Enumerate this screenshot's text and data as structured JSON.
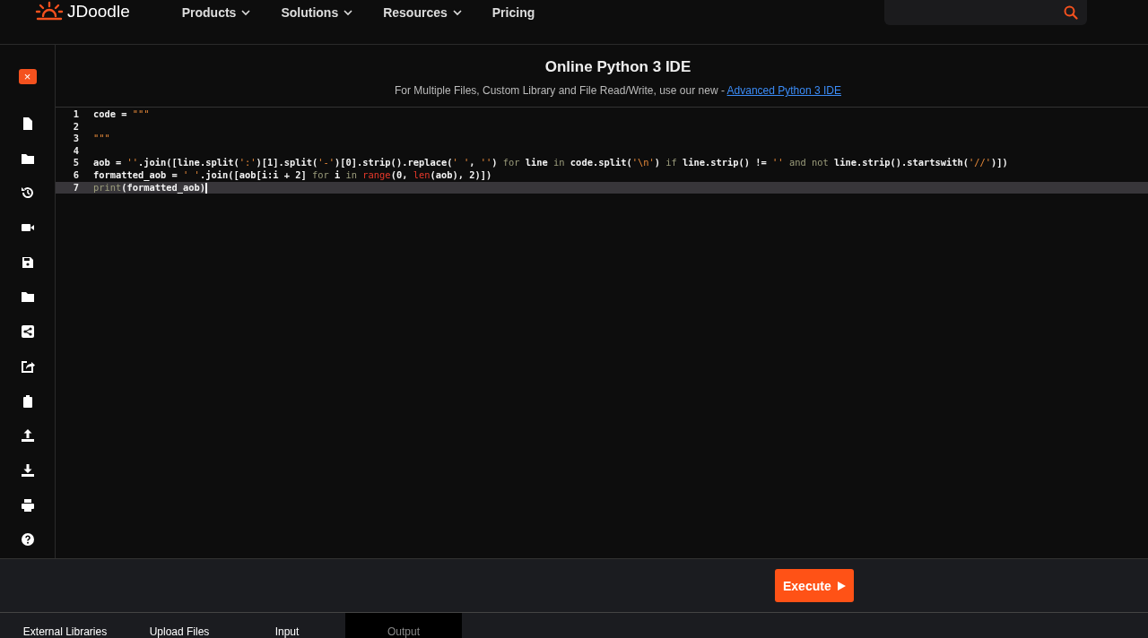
{
  "header": {
    "logo": "JDoodle",
    "nav": [
      {
        "label": "Products",
        "dropdown": true
      },
      {
        "label": "Solutions",
        "dropdown": true
      },
      {
        "label": "Resources",
        "dropdown": true
      },
      {
        "label": "Pricing",
        "dropdown": false
      }
    ]
  },
  "sidebar": {
    "close": "×",
    "tools": [
      {
        "kind": "file"
      },
      {
        "kind": "folder"
      },
      {
        "kind": "history"
      },
      {
        "kind": "video"
      },
      {
        "kind": "save"
      },
      {
        "kind": "folder"
      },
      {
        "kind": "share"
      },
      {
        "kind": "export"
      },
      {
        "kind": "clipboard"
      },
      {
        "kind": "upload"
      },
      {
        "kind": "download"
      },
      {
        "kind": "print"
      },
      {
        "kind": "help"
      }
    ]
  },
  "title": "Online Python 3 IDE",
  "subtitle": {
    "text": "For Multiple Files, Custom Library and File Read/Write, use our new - ",
    "link": "Advanced Python 3 IDE"
  },
  "editor": {
    "lines": [
      {
        "number": "1",
        "selected": false,
        "tokens": [
          {
            "text": "code = ",
            "kind": "plain"
          },
          {
            "text": "\"\"\"",
            "kind": "string"
          }
        ]
      },
      {
        "number": "2",
        "selected": false
      },
      {
        "number": "3",
        "selected": false,
        "tokens": [
          {
            "text": "\"\"\"",
            "kind": "string"
          }
        ]
      },
      {
        "number": "4",
        "selected": false
      },
      {
        "number": "5",
        "selected": false,
        "tokens": [
          {
            "text": "aob = ",
            "kind": "plain"
          },
          {
            "text": "''",
            "kind": "string"
          },
          {
            "text": ".join([line.split(",
            "kind": "plain"
          },
          {
            "text": "':'",
            "kind": "string"
          },
          {
            "text": ")[1].split(",
            "kind": "plain"
          },
          {
            "text": "'-'",
            "kind": "string"
          },
          {
            "text": ")[0].strip().replace(",
            "kind": "plain"
          },
          {
            "text": "' '",
            "kind": "string"
          },
          {
            "text": ", ",
            "kind": "plain"
          },
          {
            "text": "''",
            "kind": "string"
          },
          {
            "text": ") ",
            "kind": "plain"
          },
          {
            "text": "for",
            "kind": "keyword"
          },
          {
            "text": " line ",
            "kind": "plain"
          },
          {
            "text": "in",
            "kind": "keyword"
          },
          {
            "text": " code.split(",
            "kind": "plain"
          },
          {
            "text": "'\\n'",
            "kind": "string"
          },
          {
            "text": ") ",
            "kind": "plain"
          },
          {
            "text": "if",
            "kind": "keyword"
          },
          {
            "text": " line.strip() != ",
            "kind": "plain"
          },
          {
            "text": "''",
            "kind": "string"
          },
          {
            "text": " and not",
            "kind": "keyword"
          },
          {
            "text": " line.strip().startswith(",
            "kind": "plain"
          },
          {
            "text": "'//'",
            "kind": "string"
          },
          {
            "text": ")])",
            "kind": "plain"
          }
        ]
      },
      {
        "number": "6",
        "selected": false,
        "tokens": [
          {
            "text": "formatted_aob = ",
            "kind": "plain"
          },
          {
            "text": "' '",
            "kind": "string"
          },
          {
            "text": ".join([aob[i:i + 2] ",
            "kind": "plain"
          },
          {
            "text": "for",
            "kind": "keyword"
          },
          {
            "text": " i ",
            "kind": "plain"
          },
          {
            "text": "in ",
            "kind": "keyword"
          },
          {
            "text": "range",
            "kind": "builtin"
          },
          {
            "text": "(0, ",
            "kind": "plain"
          },
          {
            "text": "len",
            "kind": "builtin"
          },
          {
            "text": "(aob), 2)])",
            "kind": "plain"
          }
        ]
      },
      {
        "number": "7",
        "selected": true,
        "tokens": [
          {
            "text": "print",
            "kind": "keyword"
          },
          {
            "text": "(formatted_aob)",
            "kind": "plain"
          }
        ]
      }
    ]
  },
  "execute": {
    "label": "Execute"
  },
  "tabs": [
    {
      "label": "External Libraries",
      "selected": false
    },
    {
      "label": "Upload Files",
      "selected": false
    },
    {
      "label": "Input",
      "selected": false
    },
    {
      "label": "Output",
      "selected": true
    }
  ]
}
